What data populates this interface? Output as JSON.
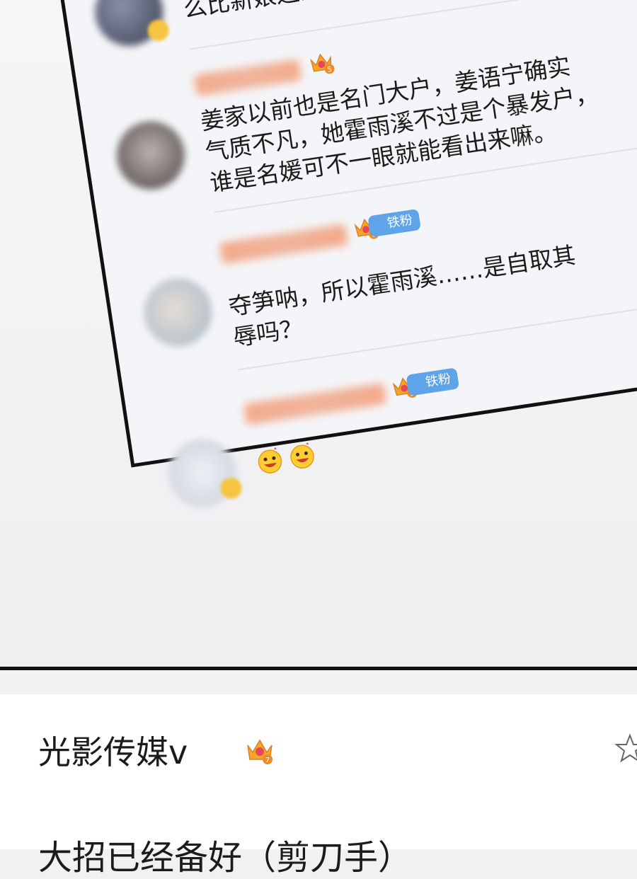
{
  "comments": [
    {
      "text": "妈呀，\n么比新娘还漂亮？"
    },
    {
      "level": "5",
      "text": "姜家以前也是名门大户，姜语宁确实\n气质不凡，她霍雨溪不过是个暴发户，\n谁是名媛可不一眼就能看出来嘛。"
    },
    {
      "level": "6",
      "fan_tag": "铁粉",
      "text": "夺笋呐，所以霍雨溪……是自取其\n辱吗？"
    },
    {
      "level": "5",
      "fan_tag": "铁粉",
      "emojis": [
        "grin-emoji",
        "grin-emoji"
      ]
    }
  ],
  "post": {
    "author": "光影传媒v",
    "level": "7",
    "text": "大招已经备好（剪刀手）"
  },
  "colors": {
    "crown": "#f5a623",
    "fan_tag": "#5fa3e8",
    "blurred_name": "#f3a98a"
  }
}
